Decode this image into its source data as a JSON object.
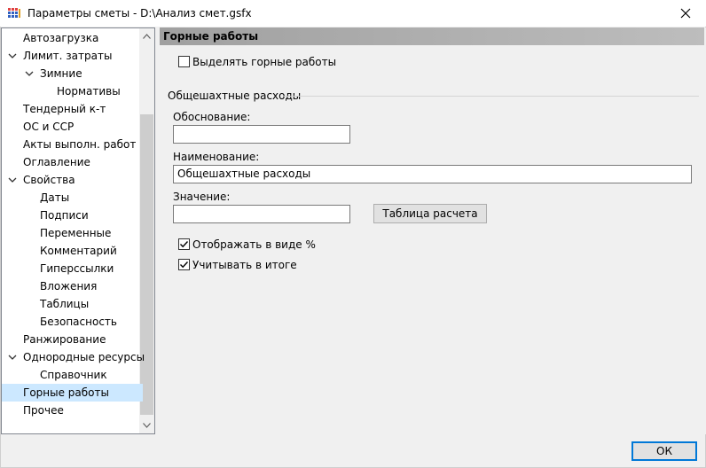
{
  "window": {
    "title": "Параметры сметы - D:\\Анализ смет.gsfx"
  },
  "tree": {
    "items": [
      {
        "label": "Автозагрузка",
        "level": 0,
        "expander": false,
        "selected": false
      },
      {
        "label": "Лимит. затраты",
        "level": 0,
        "expander": true,
        "selected": false
      },
      {
        "label": "Зимние",
        "level": 1,
        "expander": true,
        "selected": false
      },
      {
        "label": "Нормативы",
        "level": 2,
        "expander": false,
        "selected": false
      },
      {
        "label": "Тендерный к-т",
        "level": 0,
        "expander": false,
        "selected": false
      },
      {
        "label": "ОС и ССР",
        "level": 0,
        "expander": false,
        "selected": false
      },
      {
        "label": "Акты выполн. работ",
        "level": 0,
        "expander": false,
        "selected": false
      },
      {
        "label": "Оглавление",
        "level": 0,
        "expander": false,
        "selected": false
      },
      {
        "label": "Свойства",
        "level": 0,
        "expander": true,
        "selected": false
      },
      {
        "label": "Даты",
        "level": 1,
        "expander": false,
        "selected": false
      },
      {
        "label": "Подписи",
        "level": 1,
        "expander": false,
        "selected": false
      },
      {
        "label": "Переменные",
        "level": 1,
        "expander": false,
        "selected": false
      },
      {
        "label": "Комментарий",
        "level": 1,
        "expander": false,
        "selected": false
      },
      {
        "label": "Гиперссылки",
        "level": 1,
        "expander": false,
        "selected": false
      },
      {
        "label": "Вложения",
        "level": 1,
        "expander": false,
        "selected": false
      },
      {
        "label": "Таблицы",
        "level": 1,
        "expander": false,
        "selected": false
      },
      {
        "label": "Безопасность",
        "level": 1,
        "expander": false,
        "selected": false
      },
      {
        "label": "Ранжирование",
        "level": 0,
        "expander": false,
        "selected": false
      },
      {
        "label": "Однородные ресурсы",
        "level": 0,
        "expander": true,
        "selected": false
      },
      {
        "label": "Справочник",
        "level": 1,
        "expander": false,
        "selected": false
      },
      {
        "label": "Горные работы",
        "level": 0,
        "expander": false,
        "selected": true
      },
      {
        "label": "Прочее",
        "level": 0,
        "expander": false,
        "selected": false
      }
    ]
  },
  "panel": {
    "header": "Горные работы",
    "highlight_checkbox": {
      "label": "Выделять горные работы",
      "checked": false
    },
    "group": {
      "title": "Общешахтные расходы",
      "justification": {
        "label": "Обоснование:",
        "value": ""
      },
      "name": {
        "label": "Наименование:",
        "value": "Общешахтные расходы"
      },
      "value": {
        "label": "Значение:",
        "value": ""
      },
      "calc_table_button": "Таблица расчета",
      "show_percent": {
        "label": "Отображать в виде %",
        "checked": true
      },
      "include_total": {
        "label": "Учитывать в итоге",
        "checked": true
      }
    }
  },
  "footer": {
    "ok_label": "ОК"
  },
  "colors": {
    "selection": "#cce8ff",
    "header_gradient_start": "#a0a0a0",
    "default_button_border": "#0078d7"
  }
}
